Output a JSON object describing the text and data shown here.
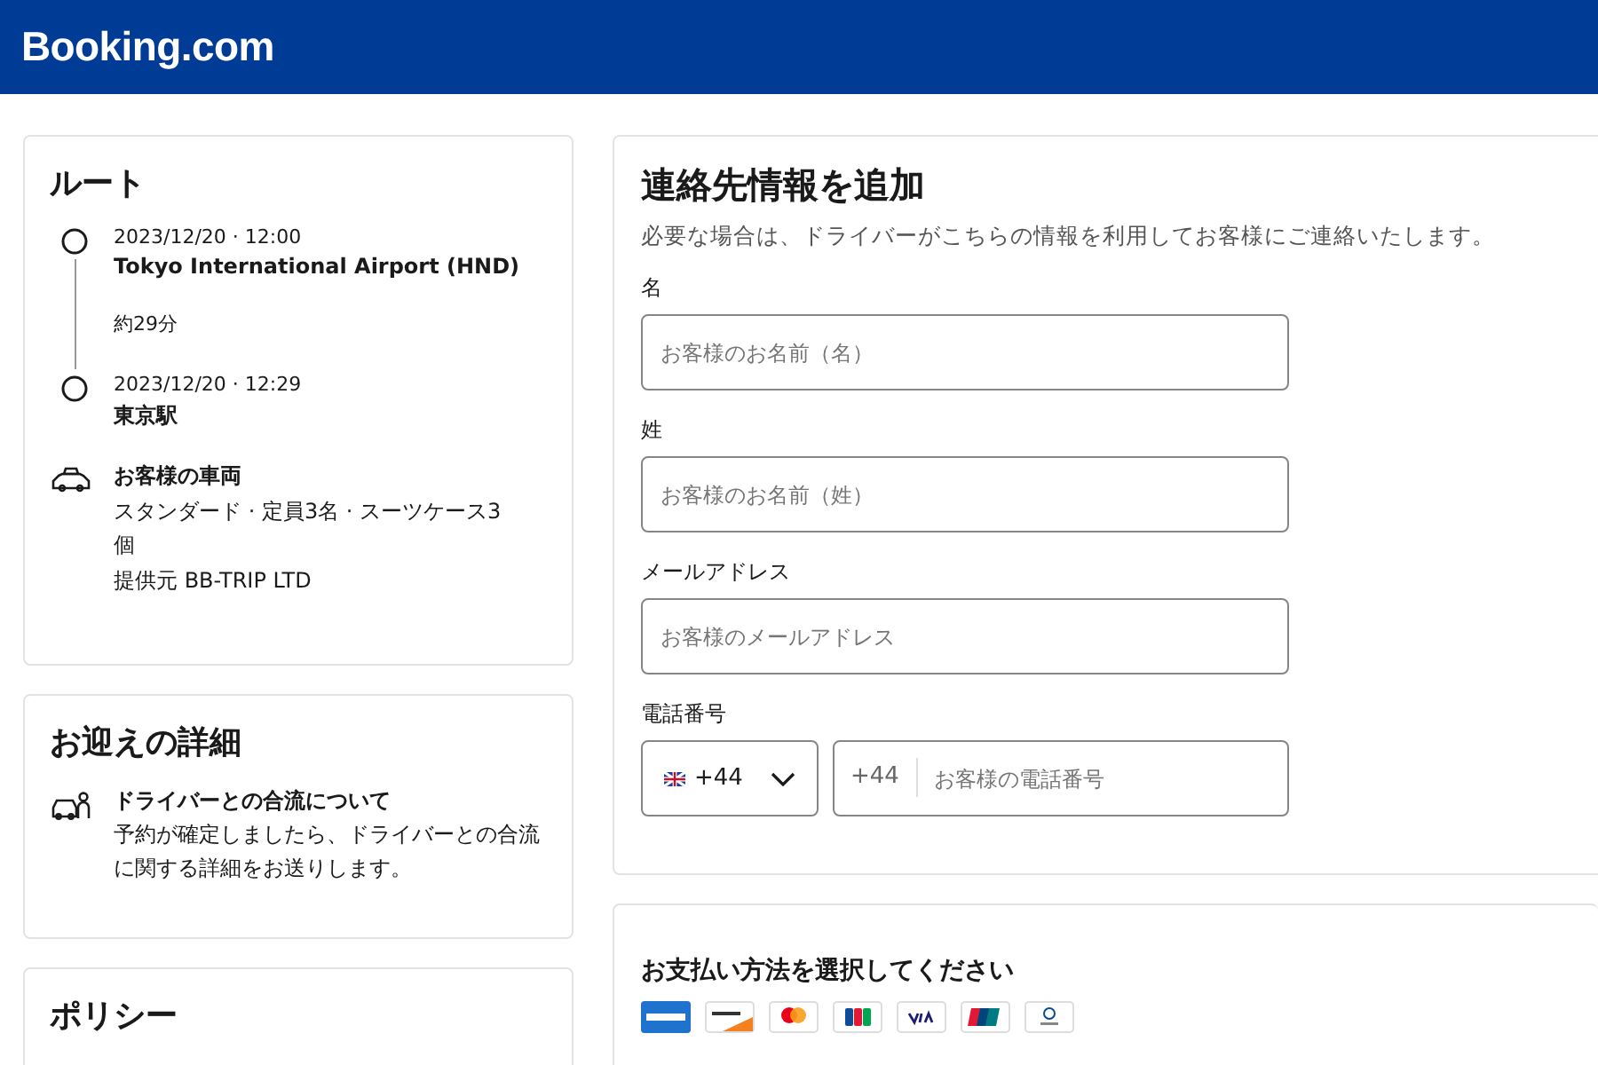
{
  "header": {
    "logo": "Booking.com"
  },
  "route": {
    "title": "ルート",
    "stops": [
      {
        "time": "2023/12/20 · 12:00",
        "place": "Tokyo International Airport (HND)"
      },
      {
        "time": "2023/12/20 · 12:29",
        "place": "東京駅"
      }
    ],
    "duration": "約29分",
    "vehicle": {
      "title": "お客様の車両",
      "detail": "スタンダード · 定員3名 · スーツケース3個",
      "provider": "提供元 BB-TRIP LTD"
    }
  },
  "pickup": {
    "title": "お迎えの詳細",
    "heading": "ドライバーとの合流について",
    "text": "予約が確定しましたら、ドライバーとの合流に関する詳細をお送りします。"
  },
  "policy": {
    "title": "ポリシー"
  },
  "contact": {
    "title": "連絡先情報を追加",
    "subtitle": "必要な場合は、ドライバーがこちらの情報を利用してお客様にご連絡いたします。",
    "fields": [
      {
        "label": "名",
        "placeholder": "お客様のお名前（名）"
      },
      {
        "label": "姓",
        "placeholder": "お客様のお名前（姓）"
      },
      {
        "label": "メールアドレス",
        "placeholder": "お客様のメールアドレス"
      }
    ],
    "phone": {
      "label": "電話番号",
      "country_code": "+44",
      "prefix": "+44",
      "placeholder": "お客様の電話番号"
    }
  },
  "payment": {
    "title": "お支払い方法を選択してください",
    "cards": [
      {
        "kind": "amex"
      },
      {
        "kind": "discover"
      },
      {
        "kind": "mastercard"
      },
      {
        "kind": "jcb"
      },
      {
        "kind": "visa"
      },
      {
        "kind": "unionpay"
      },
      {
        "kind": "diners"
      }
    ]
  }
}
